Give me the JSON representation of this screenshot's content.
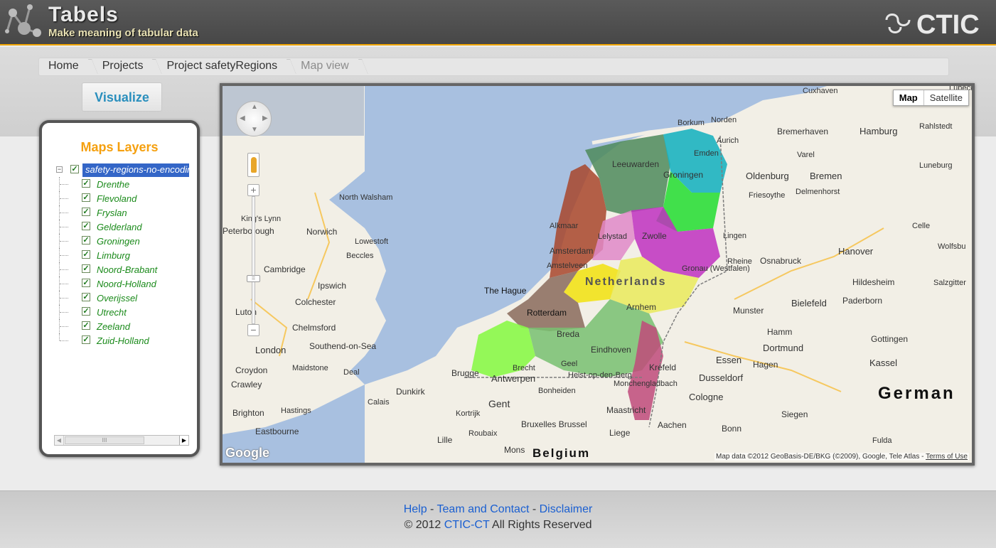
{
  "header": {
    "title": "Tabels",
    "subtitle": "Make meaning of tabular data",
    "brand": "CTIC"
  },
  "breadcrumb": {
    "items": [
      "Home",
      "Projects",
      "Project safetyRegions",
      "Map view"
    ]
  },
  "visualize_button": "Visualize",
  "layers": {
    "title": "Maps Layers",
    "root": "safety-regions-no-encoding",
    "items": [
      "Drenthe",
      "Flevoland",
      "Fryslan",
      "Gelderland",
      "Groningen",
      "Limburg",
      "Noord-Brabant",
      "Noord-Holland",
      "Overijssel",
      "Utrecht",
      "Zeeland",
      "Zuid-Holland"
    ]
  },
  "map": {
    "type_buttons": [
      "Map",
      "Satellite"
    ],
    "active_type": "Map",
    "google_logo": "Google",
    "attribution": "Map data ©2012 GeoBasis-DE/BKG (©2009), Google, Tele Atlas -",
    "terms": "Terms of Use",
    "country_labels": [
      "Netherlands",
      "Belgium",
      "German"
    ],
    "city_labels": [
      "Cuxhaven",
      "Lubeck",
      "Borkum",
      "Norden",
      "Emden",
      "Aurich",
      "Bremerhaven",
      "Hamburg",
      "Rahlstedt",
      "Leeuwarden",
      "Groningen",
      "Varel",
      "Oldenburg",
      "Bremen",
      "Luneburg",
      "Friesoythe",
      "Delmenhorst",
      "Celle",
      "Zwolle",
      "Lelystad",
      "Alkmaar",
      "Amsterdam",
      "Amstelveen",
      "Lingen",
      "Rheine",
      "Osnabruck",
      "Hanover",
      "Wolfsbu",
      "Hildesheim",
      "Salzgitter",
      "Gronau (Westfalen)",
      "Bielefeld",
      "Paderborn",
      "Munster",
      "Hamm",
      "Gottingen",
      "The Hague",
      "Rotterdam",
      "Arnhem",
      "Breda",
      "Eindhoven",
      "Dortmund",
      "Essen",
      "Krefeld",
      "Dusseldorf",
      "Hagen",
      "Kassel",
      "Antwerpen",
      "Brugge",
      "Gent",
      "Monchengladbach",
      "Cologne",
      "Siegen",
      "Bonn",
      "Maastricht",
      "Aachen",
      "Liege",
      "Bruxelles Brussel",
      "Kortrijk",
      "Roubaix",
      "Lille",
      "Mons",
      "Fulda",
      "Calais",
      "Dunkirk",
      "North Walsham",
      "King's Lynn",
      "Peterborough",
      "Norwich",
      "Lowestoft",
      "Beccles",
      "Cambridge",
      "Ipswich",
      "Colchester",
      "Chelmsford",
      "Luton",
      "London",
      "Croydon",
      "Maidstone",
      "Southend-on-Sea",
      "Crawley",
      "Brighton",
      "Hastings",
      "Eastbourne",
      "Deal",
      "Heist-op-den-Berg",
      "Geel",
      "Bonheiden",
      "Brecht"
    ]
  },
  "footer": {
    "help": "Help",
    "sep1": "-",
    "team": "Team and Contact",
    "sep2": "-",
    "disclaimer": "Disclaimer",
    "copyright": "© 2012",
    "company": "CTIC-CT",
    "rights": "All Rights Reserved"
  }
}
